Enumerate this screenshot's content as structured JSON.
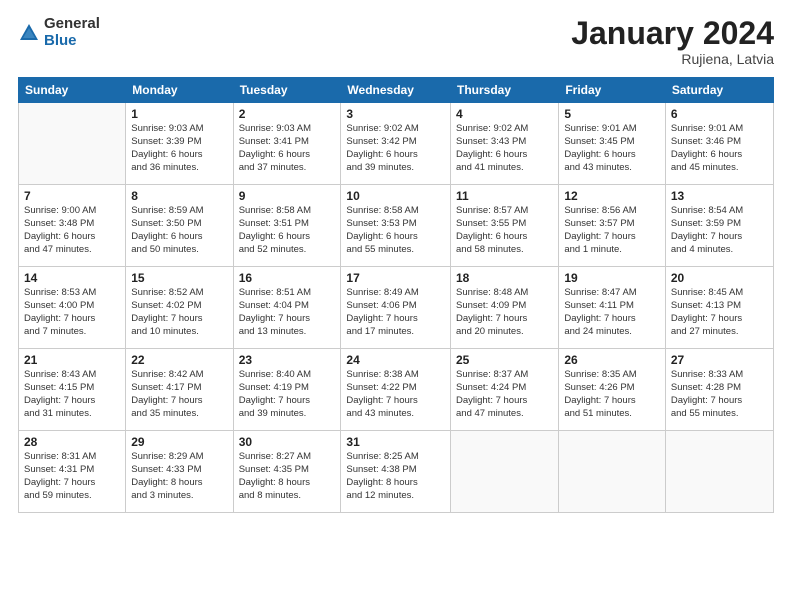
{
  "header": {
    "logo_general": "General",
    "logo_blue": "Blue",
    "month_title": "January 2024",
    "location": "Rujiena, Latvia"
  },
  "weekdays": [
    "Sunday",
    "Monday",
    "Tuesday",
    "Wednesday",
    "Thursday",
    "Friday",
    "Saturday"
  ],
  "weeks": [
    [
      {
        "day": "",
        "info": ""
      },
      {
        "day": "1",
        "info": "Sunrise: 9:03 AM\nSunset: 3:39 PM\nDaylight: 6 hours\nand 36 minutes."
      },
      {
        "day": "2",
        "info": "Sunrise: 9:03 AM\nSunset: 3:41 PM\nDaylight: 6 hours\nand 37 minutes."
      },
      {
        "day": "3",
        "info": "Sunrise: 9:02 AM\nSunset: 3:42 PM\nDaylight: 6 hours\nand 39 minutes."
      },
      {
        "day": "4",
        "info": "Sunrise: 9:02 AM\nSunset: 3:43 PM\nDaylight: 6 hours\nand 41 minutes."
      },
      {
        "day": "5",
        "info": "Sunrise: 9:01 AM\nSunset: 3:45 PM\nDaylight: 6 hours\nand 43 minutes."
      },
      {
        "day": "6",
        "info": "Sunrise: 9:01 AM\nSunset: 3:46 PM\nDaylight: 6 hours\nand 45 minutes."
      }
    ],
    [
      {
        "day": "7",
        "info": "Sunrise: 9:00 AM\nSunset: 3:48 PM\nDaylight: 6 hours\nand 47 minutes."
      },
      {
        "day": "8",
        "info": "Sunrise: 8:59 AM\nSunset: 3:50 PM\nDaylight: 6 hours\nand 50 minutes."
      },
      {
        "day": "9",
        "info": "Sunrise: 8:58 AM\nSunset: 3:51 PM\nDaylight: 6 hours\nand 52 minutes."
      },
      {
        "day": "10",
        "info": "Sunrise: 8:58 AM\nSunset: 3:53 PM\nDaylight: 6 hours\nand 55 minutes."
      },
      {
        "day": "11",
        "info": "Sunrise: 8:57 AM\nSunset: 3:55 PM\nDaylight: 6 hours\nand 58 minutes."
      },
      {
        "day": "12",
        "info": "Sunrise: 8:56 AM\nSunset: 3:57 PM\nDaylight: 7 hours\nand 1 minute."
      },
      {
        "day": "13",
        "info": "Sunrise: 8:54 AM\nSunset: 3:59 PM\nDaylight: 7 hours\nand 4 minutes."
      }
    ],
    [
      {
        "day": "14",
        "info": "Sunrise: 8:53 AM\nSunset: 4:00 PM\nDaylight: 7 hours\nand 7 minutes."
      },
      {
        "day": "15",
        "info": "Sunrise: 8:52 AM\nSunset: 4:02 PM\nDaylight: 7 hours\nand 10 minutes."
      },
      {
        "day": "16",
        "info": "Sunrise: 8:51 AM\nSunset: 4:04 PM\nDaylight: 7 hours\nand 13 minutes."
      },
      {
        "day": "17",
        "info": "Sunrise: 8:49 AM\nSunset: 4:06 PM\nDaylight: 7 hours\nand 17 minutes."
      },
      {
        "day": "18",
        "info": "Sunrise: 8:48 AM\nSunset: 4:09 PM\nDaylight: 7 hours\nand 20 minutes."
      },
      {
        "day": "19",
        "info": "Sunrise: 8:47 AM\nSunset: 4:11 PM\nDaylight: 7 hours\nand 24 minutes."
      },
      {
        "day": "20",
        "info": "Sunrise: 8:45 AM\nSunset: 4:13 PM\nDaylight: 7 hours\nand 27 minutes."
      }
    ],
    [
      {
        "day": "21",
        "info": "Sunrise: 8:43 AM\nSunset: 4:15 PM\nDaylight: 7 hours\nand 31 minutes."
      },
      {
        "day": "22",
        "info": "Sunrise: 8:42 AM\nSunset: 4:17 PM\nDaylight: 7 hours\nand 35 minutes."
      },
      {
        "day": "23",
        "info": "Sunrise: 8:40 AM\nSunset: 4:19 PM\nDaylight: 7 hours\nand 39 minutes."
      },
      {
        "day": "24",
        "info": "Sunrise: 8:38 AM\nSunset: 4:22 PM\nDaylight: 7 hours\nand 43 minutes."
      },
      {
        "day": "25",
        "info": "Sunrise: 8:37 AM\nSunset: 4:24 PM\nDaylight: 7 hours\nand 47 minutes."
      },
      {
        "day": "26",
        "info": "Sunrise: 8:35 AM\nSunset: 4:26 PM\nDaylight: 7 hours\nand 51 minutes."
      },
      {
        "day": "27",
        "info": "Sunrise: 8:33 AM\nSunset: 4:28 PM\nDaylight: 7 hours\nand 55 minutes."
      }
    ],
    [
      {
        "day": "28",
        "info": "Sunrise: 8:31 AM\nSunset: 4:31 PM\nDaylight: 7 hours\nand 59 minutes."
      },
      {
        "day": "29",
        "info": "Sunrise: 8:29 AM\nSunset: 4:33 PM\nDaylight: 8 hours\nand 3 minutes."
      },
      {
        "day": "30",
        "info": "Sunrise: 8:27 AM\nSunset: 4:35 PM\nDaylight: 8 hours\nand 8 minutes."
      },
      {
        "day": "31",
        "info": "Sunrise: 8:25 AM\nSunset: 4:38 PM\nDaylight: 8 hours\nand 12 minutes."
      },
      {
        "day": "",
        "info": ""
      },
      {
        "day": "",
        "info": ""
      },
      {
        "day": "",
        "info": ""
      }
    ]
  ]
}
